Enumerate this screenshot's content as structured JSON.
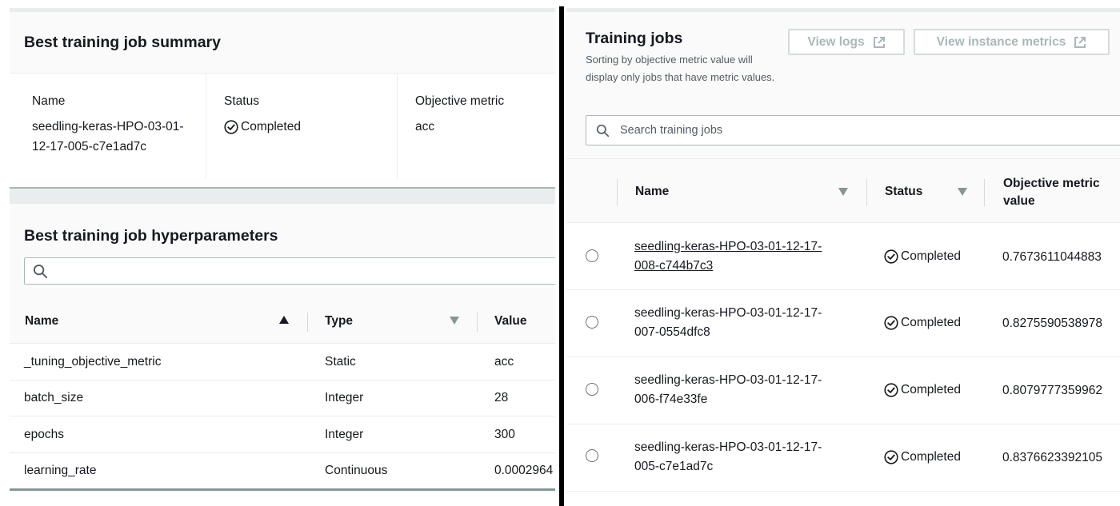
{
  "summary": {
    "title": "Best training job summary",
    "name_label": "Name",
    "name_value": "seedling-keras-HPO-03-01-12-17-005-c7e1ad7c",
    "status_label": "Status",
    "status_value": "Completed",
    "metric_label": "Objective metric",
    "metric_value": "acc"
  },
  "hyperparameters": {
    "title": "Best training job hyperparameters",
    "search_placeholder": "",
    "columns": {
      "name": "Name",
      "type": "Type",
      "value": "Value"
    },
    "rows": [
      {
        "name": "_tuning_objective_metric",
        "type": "Static",
        "value": "acc"
      },
      {
        "name": "batch_size",
        "type": "Integer",
        "value": "28"
      },
      {
        "name": "epochs",
        "type": "Integer",
        "value": "300"
      },
      {
        "name": "learning_rate",
        "type": "Continuous",
        "value": "0.0002964"
      }
    ]
  },
  "training_jobs": {
    "title": "Training jobs",
    "description": "Sorting by objective metric value will display only jobs that have metric values.",
    "view_logs_label": "View logs",
    "view_metrics_label": "View instance metrics",
    "search_placeholder": "Search training jobs",
    "columns": {
      "name": "Name",
      "status": "Status",
      "metric_line1": "Objective metric",
      "metric_line2": "value"
    },
    "rows": [
      {
        "name_line1": "seedling-keras-HPO-03-01-12-17-",
        "name_line2": "008-c744b7c3",
        "status": "Completed",
        "value": "0.7673611044883"
      },
      {
        "name_line1": "seedling-keras-HPO-03-01-12-17-",
        "name_line2": "007-0554dfc8",
        "status": "Completed",
        "value": "0.8275590538978"
      },
      {
        "name_line1": "seedling-keras-HPO-03-01-12-17-",
        "name_line2": "006-f74e33fe",
        "status": "Completed",
        "value": "0.8079777359962"
      },
      {
        "name_line1": "seedling-keras-HPO-03-01-12-17-",
        "name_line2": "005-c7e1ad7c",
        "status": "Completed",
        "value": "0.8376623392105"
      }
    ]
  },
  "colors": {
    "text": "#16191f",
    "muted": "#545b64",
    "border": "#eaeded",
    "disabled_button": "#aab7b8",
    "success": "#1d8102"
  },
  "icons": {
    "status": "check-circle-icon",
    "search": "search-icon",
    "external": "external-link-icon",
    "sort_asc": "caret-up-icon",
    "sort_desc": "caret-down-icon"
  }
}
